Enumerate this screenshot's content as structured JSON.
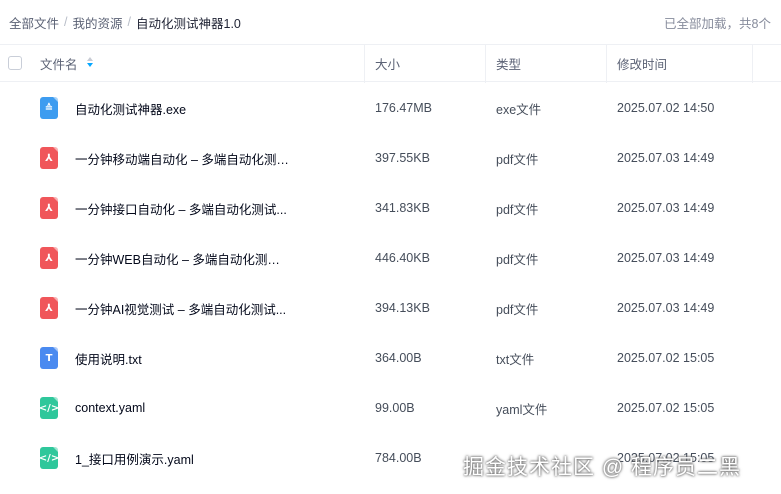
{
  "breadcrumb": {
    "items": [
      "全部文件",
      "我的资源"
    ],
    "current": "自动化测试神器1.0",
    "separator": "/"
  },
  "load_status": "已全部加载，共8个",
  "columns": {
    "name": "文件名",
    "size": "大小",
    "type": "类型",
    "time": "修改时间"
  },
  "files": [
    {
      "icon": "exe-file-icon",
      "color": "#3d9cf0",
      "glyph": "≙",
      "name": "自动化测试神器.exe",
      "size": "176.47MB",
      "type": "exe文件",
      "time": "2025.07.02 14:50"
    },
    {
      "icon": "pdf-file-icon",
      "color": "#f0565a",
      "glyph": "⅄",
      "name": "一分钟移动端自动化 – 多端自动化测试...",
      "size": "397.55KB",
      "type": "pdf文件",
      "time": "2025.07.03 14:49"
    },
    {
      "icon": "pdf-file-icon",
      "color": "#f0565a",
      "glyph": "⅄",
      "name": "一分钟接口自动化 – 多端自动化测试...",
      "size": "341.83KB",
      "type": "pdf文件",
      "time": "2025.07.03 14:49"
    },
    {
      "icon": "pdf-file-icon",
      "color": "#f0565a",
      "glyph": "⅄",
      "name": "一分钟WEB自动化 – 多端自动化测试...",
      "size": "446.40KB",
      "type": "pdf文件",
      "time": "2025.07.03 14:49"
    },
    {
      "icon": "pdf-file-icon",
      "color": "#f0565a",
      "glyph": "⅄",
      "name": "一分钟AI视觉测试 – 多端自动化测试...",
      "size": "394.13KB",
      "type": "pdf文件",
      "time": "2025.07.03 14:49"
    },
    {
      "icon": "txt-file-icon",
      "color": "#4a8af0",
      "glyph": "T",
      "name": "使用说明.txt",
      "size": "364.00B",
      "type": "txt文件",
      "time": "2025.07.02 15:05"
    },
    {
      "icon": "code-file-icon",
      "color": "#2fc79b",
      "glyph": "</>",
      "name": "context.yaml",
      "size": "99.00B",
      "type": "yaml文件",
      "time": "2025.07.02 15:05"
    },
    {
      "icon": "code-file-icon",
      "color": "#2fc79b",
      "glyph": "</>",
      "name": "1_接口用例演示.yaml",
      "size": "784.00B",
      "type": "",
      "time": "2025.07.02 15:05"
    }
  ],
  "watermark": "掘金技术社区 @ 程序员二黑"
}
